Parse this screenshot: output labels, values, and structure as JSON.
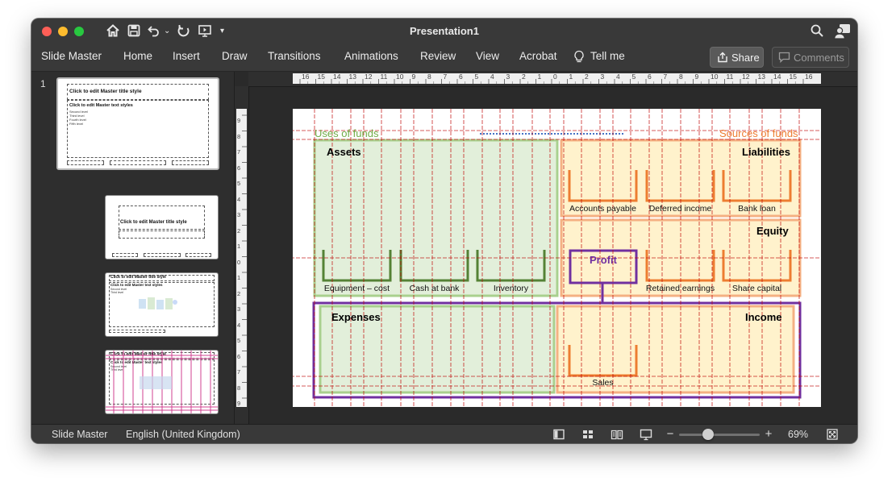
{
  "window": {
    "title": "Presentation1"
  },
  "quick_access": {
    "icons": [
      "home-icon",
      "save-icon",
      "undo-icon",
      "undo-dropdown-icon",
      "redo-icon",
      "present-icon",
      "customize-icon"
    ]
  },
  "ribbon": {
    "tabs": [
      "Slide Master",
      "Home",
      "Insert",
      "Draw",
      "Transitions",
      "Animations",
      "Review",
      "View",
      "Acrobat",
      "Tell me"
    ],
    "share_label": "Share",
    "comments_label": "Comments"
  },
  "thumbnails": {
    "selected_number": "1",
    "master": {
      "title": "Click to edit Master title style",
      "body_title": "Click to edit Master text styles",
      "levels": [
        "Second level",
        "Third level",
        "Fourth level",
        "Fifth level"
      ]
    },
    "layout_title": "Click to edit Master title style",
    "layout_small_title": "Click to edit Master title style",
    "layout_small_body": "Click to edit Master text styles",
    "layout_small_levels": [
      "Second level",
      "Third level"
    ]
  },
  "ruler": {
    "horizontal": [
      "16",
      "15",
      "14",
      "13",
      "12",
      "11",
      "10",
      "9",
      "8",
      "7",
      "6",
      "5",
      "4",
      "3",
      "2",
      "1",
      "0",
      "1",
      "2",
      "3",
      "4",
      "5",
      "6",
      "7",
      "8",
      "9",
      "10",
      "11",
      "12",
      "13",
      "14",
      "15",
      "16"
    ],
    "vertical": [
      "9",
      "8",
      "7",
      "6",
      "5",
      "4",
      "3",
      "2",
      "1",
      "0",
      "1",
      "2",
      "3",
      "4",
      "5",
      "6",
      "7",
      "8",
      "9"
    ]
  },
  "slide": {
    "uses_of_funds": "Uses of funds",
    "sources_of_funds": "Sources of funds",
    "assets": "Assets",
    "liabilities": "Liabilities",
    "equity": "Equity",
    "expenses": "Expenses",
    "income": "Income",
    "profit": "Profit",
    "asset_items": [
      "Equipment – cost",
      "Cash at bank",
      "Inventory"
    ],
    "liability_items": [
      "Accounts payable",
      "Deferred income",
      "Bank loan"
    ],
    "equity_items": [
      "Retained earnings",
      "Share capital"
    ],
    "income_items": [
      "Sales"
    ],
    "colors": {
      "green_fill": "#e2efda",
      "green_border": "#a9d08e",
      "green_text": "#70ad47",
      "dark_green": "#548235",
      "orange_fill": "#fff2cc",
      "orange_border": "#f4b183",
      "orange_text": "#ed7d31",
      "purple": "#7030a0",
      "guide_red": "#c00000"
    }
  },
  "statusbar": {
    "view_label": "Slide Master",
    "language": "English (United Kingdom)",
    "zoom": "69%",
    "zoom_level": 0.69,
    "icons": [
      "normal-view-icon",
      "slide-sorter-icon",
      "reading-view-icon",
      "slideshow-icon",
      "zoom-out-icon",
      "zoom-in-icon",
      "fit-slide-icon"
    ]
  }
}
